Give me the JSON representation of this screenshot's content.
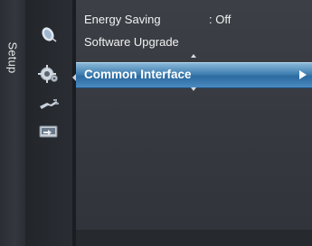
{
  "sidebar": {
    "tab_label": "Setup",
    "icons": [
      "satellite-icon",
      "gear-icon",
      "plug-icon",
      "input-icon"
    ]
  },
  "menu": {
    "items": [
      {
        "label": "Energy Saving",
        "value": ": Off"
      },
      {
        "label": "Software Upgrade",
        "value": ""
      }
    ],
    "selected": {
      "label": "Common Interface",
      "arrow": "▶"
    }
  },
  "colors": {
    "selection_top": "#8ab8d8",
    "selection_mid": "#2c6aa0",
    "panel": "#3c4046",
    "text": "#f2f2f2"
  }
}
